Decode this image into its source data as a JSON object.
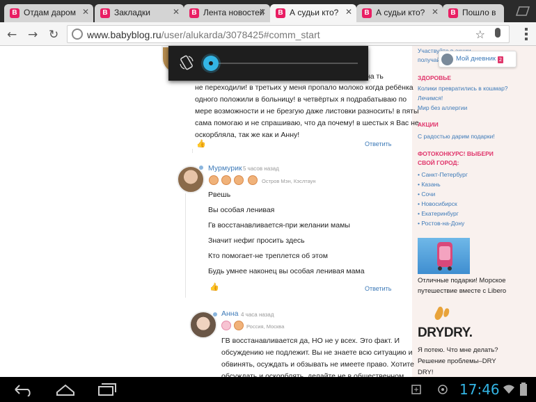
{
  "tabs": [
    {
      "title": "Отдам даром",
      "active": false
    },
    {
      "title": "Закладки",
      "active": false
    },
    {
      "title": "Лента новостей",
      "active": false
    },
    {
      "title": "А судьи кто?",
      "active": true
    },
    {
      "title": "А судьи кто?",
      "active": false
    },
    {
      "title": "Пошло в",
      "active": false
    }
  ],
  "toolbar": {
    "url_host": "www.babyblog.ru",
    "url_path": "/user/alukarda/3078425#comm_start"
  },
  "comment1": {
    "line0": "ми на ть",
    "lines": [
      "не переходили! в третьих у меня пропало молоко когда ребёнка",
      "одного положили в больницу! в четвёртых я подрабатываю по",
      "мере возможности и не брезгую даже листовки разносить! в пяты",
      "сама помогаю и не спрашиваю, что да почему! в шестых я Вас не",
      "оскорбляла, так же как и Анну!"
    ],
    "reply": "Ответить"
  },
  "comment2": {
    "author": "Мурмурик",
    "time": "5 часов назад",
    "location": "Остров Мэн, Кэслтаун",
    "lines": [
      "Рвешь",
      "Вы особая ленивая",
      "Гв восстанавливается-при желании мамы",
      "Значит нефиг просить здесь",
      "Кто помогает-не треплется об этом",
      "Будь умнее наконец вы особая ленивая мама"
    ],
    "reply": "Ответить"
  },
  "comment3": {
    "author": "Анна",
    "time": "4 часа назад",
    "location": "Россия, Москва",
    "lines": [
      "ГВ восстанавливается да, НО не у всех. Это факт. И",
      "обсуждению не подлежит. Вы не знаете всю ситуацию и",
      "обвинять, осуждать и обзывать не имеете право. Хотите",
      "обсуждать и оскорблять, делайте не в общественном"
    ]
  },
  "sidebar": {
    "top_link_1": "Участвуйте в акции",
    "top_link_2": "получайте",
    "my_diary": "Мой дневник",
    "my_diary_count": "2",
    "health_head": "ЗДОРОВЬЕ",
    "health_links": [
      "Колики превратились в кошмар?",
      "Лечимся!",
      "Мир без аллергии"
    ],
    "promo_head": "АКЦИИ",
    "promo_links": [
      "С радостью дарим подарки!"
    ],
    "photo_head_1": "ФОТОКОНКУРС! ВЫБЕРИ",
    "photo_head_2": "СВОЙ ГОРОД:",
    "cities": [
      "Санкт-Петербург",
      "Казань",
      "Сочи",
      "Новосибирск",
      "Екатеринбург",
      "Ростов-на-Дону"
    ],
    "ad1_lines": [
      "Отличные подарки! Морское",
      "путешествие вместе с Libero"
    ],
    "ad2_brand": "DRYDRY.",
    "ad2_lines": [
      "Я потею. Что мне делать?",
      "Решение проблемы–DRY",
      "DRY!"
    ]
  },
  "system": {
    "clock": "17:46"
  },
  "colors": {
    "accent": "#33b5e5",
    "brand_pink": "#e0356b",
    "link_blue": "#3d7ab8"
  }
}
